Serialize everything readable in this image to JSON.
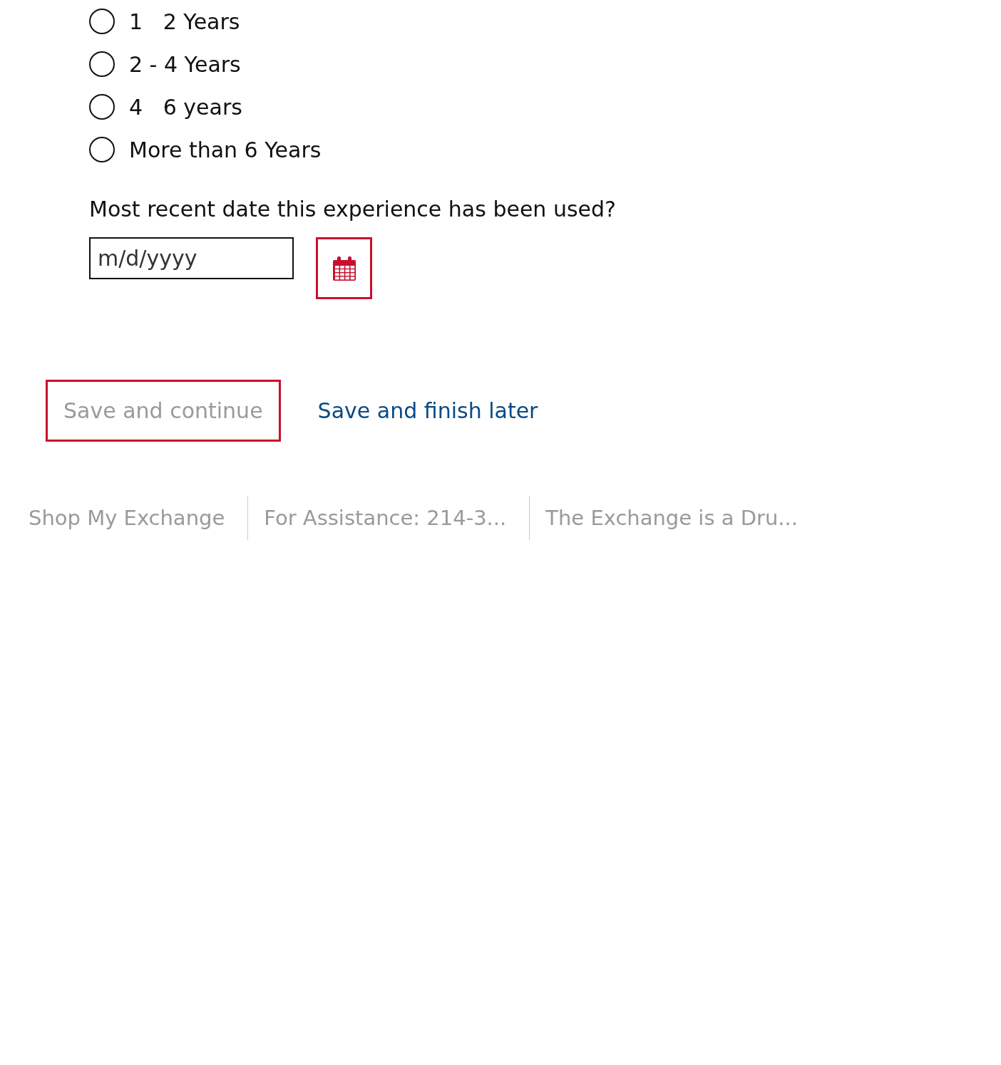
{
  "experience_options": [
    {
      "label": "1   2 Years",
      "selected": false
    },
    {
      "label": "2 - 4 Years",
      "selected": false
    },
    {
      "label": "4   6 years",
      "selected": false
    },
    {
      "label": "More than 6 Years",
      "selected": false
    }
  ],
  "date_question": {
    "label": "Most recent date this experience has been used?",
    "placeholder": "m/d/yyyy"
  },
  "actions": {
    "primary": {
      "label": "Save and continue",
      "disabled": true
    },
    "secondary": {
      "label": "Save and finish later"
    }
  },
  "footer": [
    "Shop My Exchange",
    "For Assistance: 214-3...",
    "The Exchange is a Dru..."
  ]
}
